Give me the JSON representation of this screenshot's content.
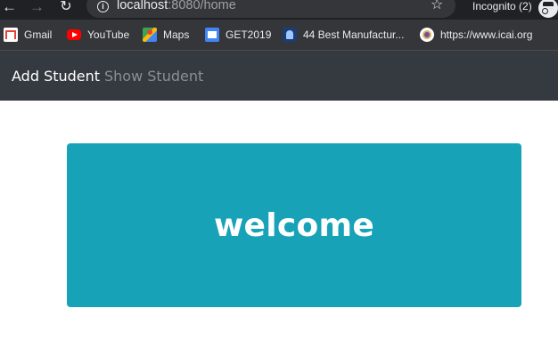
{
  "browser": {
    "url_host": "localhost",
    "url_path": ":8080/home",
    "incognito_label": "Incognito (2)"
  },
  "bookmarks": [
    {
      "label": "Gmail",
      "icon": "gmail-icon"
    },
    {
      "label": "YouTube",
      "icon": "youtube-icon"
    },
    {
      "label": "Maps",
      "icon": "maps-icon"
    },
    {
      "label": "GET2019",
      "icon": "get2019-icon"
    },
    {
      "label": "44 Best Manufactur...",
      "icon": "bookmark-site-icon"
    },
    {
      "label": "https://www.icai.org",
      "icon": "icai-icon"
    }
  ],
  "navbar": {
    "links": [
      {
        "label": "Add Student",
        "active": true
      },
      {
        "label": "Show Student",
        "active": false
      }
    ],
    "active_color": "#ffffff",
    "muted_color": "#8b8f94",
    "background": "#343a40"
  },
  "main": {
    "welcome_text": "welcome",
    "card_color": "#17a2b8"
  }
}
